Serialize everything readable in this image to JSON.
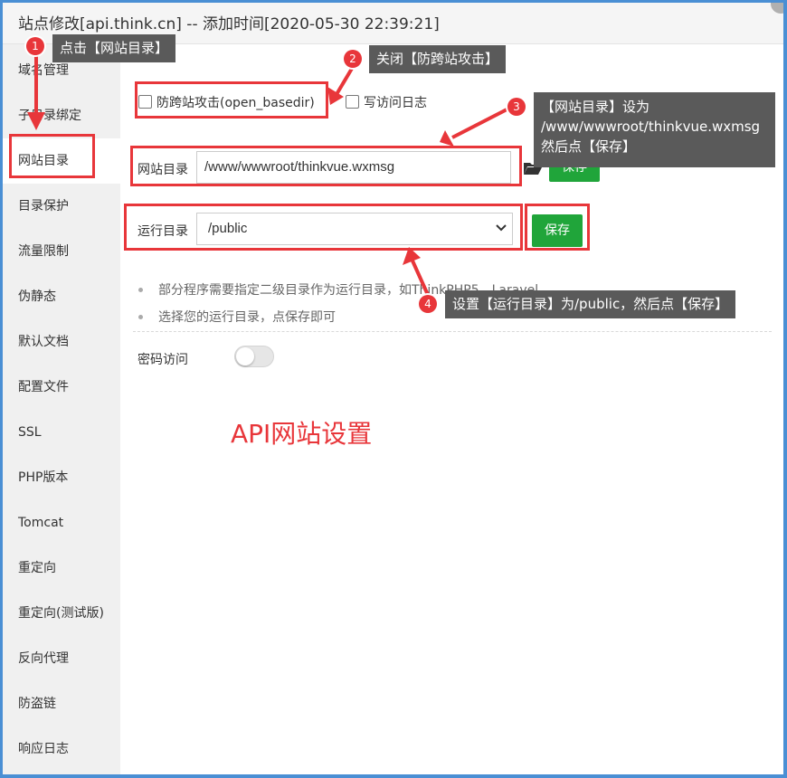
{
  "window": {
    "title": "站点修改[api.think.cn] -- 添加时间[2020-05-30 22:39:21]"
  },
  "sidebar": {
    "items": [
      {
        "label": "域名管理"
      },
      {
        "label": "子目录绑定"
      },
      {
        "label": "网站目录"
      },
      {
        "label": "目录保护"
      },
      {
        "label": "流量限制"
      },
      {
        "label": "伪静态"
      },
      {
        "label": "默认文档"
      },
      {
        "label": "配置文件"
      },
      {
        "label": "SSL"
      },
      {
        "label": "PHP版本"
      },
      {
        "label": "Tomcat"
      },
      {
        "label": "重定向"
      },
      {
        "label": "重定向(测试版)"
      },
      {
        "label": "反向代理"
      },
      {
        "label": "防盗链"
      },
      {
        "label": "响应日志"
      }
    ],
    "active_index": 2
  },
  "options": {
    "anti_cross_site": {
      "label": "防跨站攻击(open_basedir)",
      "checked": false
    },
    "write_access_log": {
      "label": "写访问日志",
      "checked": false
    }
  },
  "site_dir": {
    "label": "网站目录",
    "value": "/www/wwwroot/thinkvue.wxmsg",
    "save_label": "保存"
  },
  "run_dir": {
    "label": "运行目录",
    "value": "/public",
    "save_label": "保存"
  },
  "hints": [
    "部分程序需要指定二级目录作为运行目录，如ThinkPHP5，Laravel",
    "选择您的运行目录，点保存即可"
  ],
  "password_access": {
    "label": "密码访问",
    "enabled": false
  },
  "annotations": {
    "steps": [
      {
        "num": "1",
        "text": "点击【网站目录】"
      },
      {
        "num": "2",
        "text": "关闭【防跨站攻击】"
      },
      {
        "num": "3",
        "lines": [
          "【网站目录】设为",
          "/www/wwwroot/thinkvue.wxmsg",
          "然后点【保存】"
        ]
      },
      {
        "num": "4",
        "text": "设置【运行目录】为/public，然后点【保存】"
      }
    ],
    "caption": "API网站设置"
  },
  "colors": {
    "accent_green": "#20a53a",
    "annotation_red": "#e8363a",
    "frame_blue": "#4a8fd4"
  },
  "icons": {
    "folder": "folder-icon",
    "dropdown": "chevron-down-icon"
  }
}
